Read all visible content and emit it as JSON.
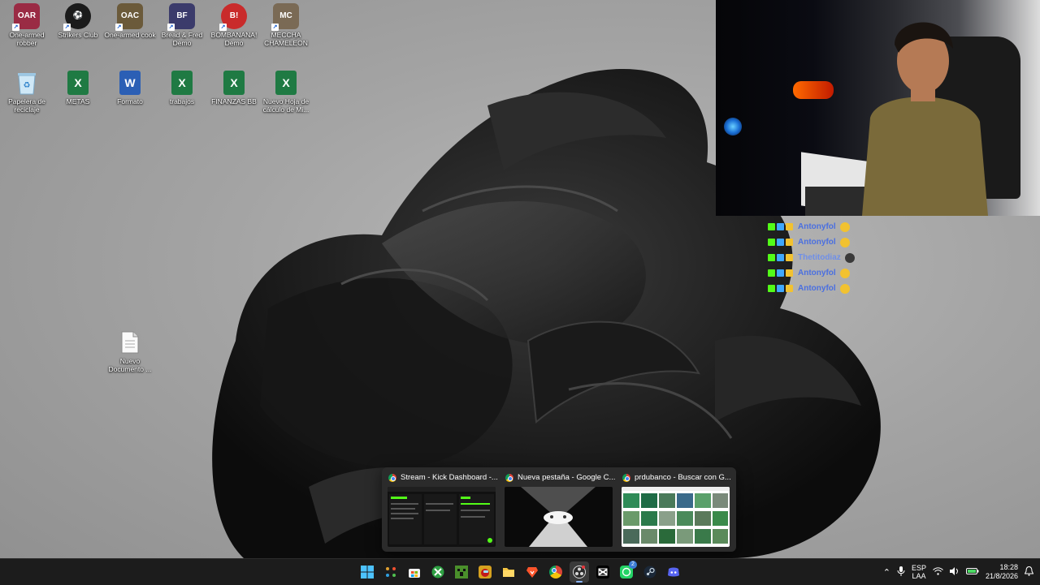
{
  "desktop": {
    "icons_row1": [
      {
        "label": "One-armed robber",
        "icon": "game-oar-icon",
        "color": "#9a2b44",
        "glyph": "OAR"
      },
      {
        "label": "Strikers Club",
        "icon": "game-strikers-icon",
        "color": "#1b1b1b",
        "glyph": "⚽"
      },
      {
        "label": "One-armed cook",
        "icon": "game-oac-icon",
        "color": "#6b5a3a",
        "glyph": "OAC"
      },
      {
        "label": "Bread & Fred Demo",
        "icon": "game-bread-fred-icon",
        "color": "#3b3b6b",
        "glyph": "BF"
      },
      {
        "label": "BOMBANANA! Demo",
        "icon": "game-bombanana-icon",
        "color": "#c92b2b",
        "glyph": "B!"
      },
      {
        "label": "MECCHA CHAMELEON",
        "icon": "game-meccha-icon",
        "color": "#7a6a55",
        "glyph": "MC"
      }
    ],
    "icons_row2": [
      {
        "label": "Papelera de reciclaje",
        "icon": "recycle-bin-icon"
      },
      {
        "label": "METAS",
        "icon": "excel-file-icon"
      },
      {
        "label": "Formato",
        "icon": "word-file-icon"
      },
      {
        "label": "trabajos",
        "icon": "excel-file-icon"
      },
      {
        "label": "FINANZAS BB",
        "icon": "excel-file-icon"
      },
      {
        "label": "Nuevo Hoja de cálculo de Mi...",
        "icon": "excel-file-icon"
      }
    ],
    "loose_icon": {
      "label": "Nuevo Documento ...",
      "icon": "text-document-icon"
    }
  },
  "chat": {
    "rows": [
      {
        "name": "Antonyfol"
      },
      {
        "name": "Antonyfol"
      },
      {
        "name": "Thetitodiaz"
      },
      {
        "name": "Antonyfol"
      },
      {
        "name": "Antonyfol"
      }
    ]
  },
  "thumbnails": [
    {
      "title": "Stream - Kick Dashboard -...",
      "icon": "chrome-icon"
    },
    {
      "title": "Nueva pestaña - Google C...",
      "icon": "chrome-icon"
    },
    {
      "title": "prdubanco - Buscar con G...",
      "icon": "chrome-icon"
    }
  ],
  "taskbar": {
    "apps": [
      {
        "name": "start-button",
        "icon": "windows-logo-icon",
        "color": "#4cc2ff"
      },
      {
        "name": "task-view-button",
        "icon": "task-view-icon",
        "color": "#ffffff"
      },
      {
        "name": "store-button",
        "icon": "store-icon",
        "color": "#f2f2f2"
      },
      {
        "name": "xbox-button",
        "icon": "xbox-icon",
        "color": "#2ea043"
      },
      {
        "name": "minecraft-button",
        "icon": "minecraft-icon",
        "color": "#4a8f2b"
      },
      {
        "name": "among-us-button",
        "icon": "game-icon",
        "color": "#d6a11f"
      },
      {
        "name": "file-explorer-button",
        "icon": "folder-icon",
        "color": "#f5c542"
      },
      {
        "name": "brave-button",
        "icon": "brave-icon",
        "color": "#fb542b"
      },
      {
        "name": "chrome-button",
        "icon": "chrome-icon",
        "color": "#4285f4"
      },
      {
        "name": "obs-button",
        "icon": "obs-icon",
        "color": "#d9d9d9"
      },
      {
        "name": "capcut-button",
        "icon": "capcut-icon",
        "color": "#ffffff"
      },
      {
        "name": "whatsapp-button",
        "icon": "whatsapp-icon",
        "color": "#25d366"
      },
      {
        "name": "steam-button",
        "icon": "steam-icon",
        "color": "#c7d5e0"
      },
      {
        "name": "discord-button",
        "icon": "discord-icon",
        "color": "#5865f2"
      }
    ],
    "whatsapp_badge": "2",
    "lang_top": "ESP",
    "lang_bottom": "LAA",
    "time": "18:28",
    "date": "21/8/2026"
  }
}
